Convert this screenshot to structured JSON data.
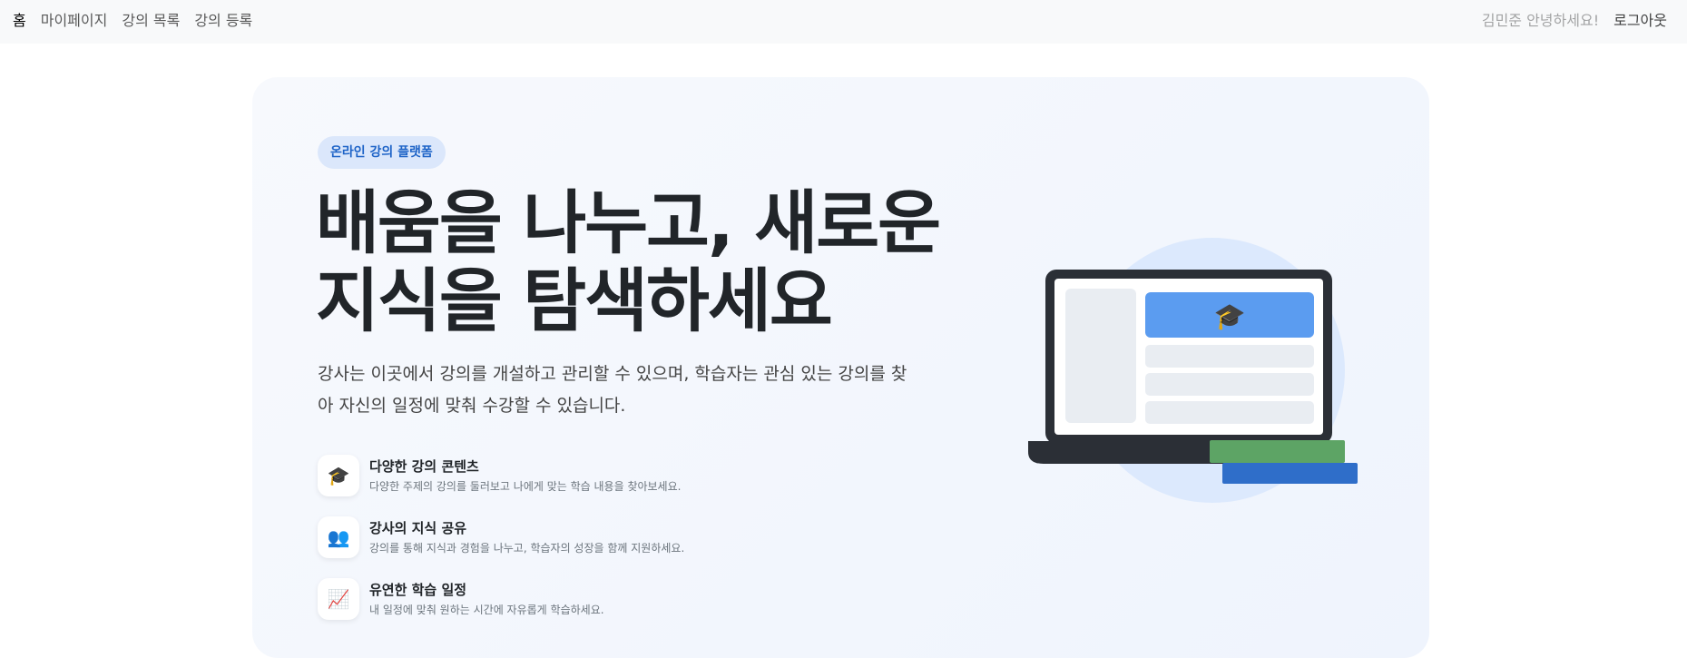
{
  "nav": {
    "home": "홈",
    "mypage": "마이페이지",
    "course_list": "강의 목록",
    "course_register": "강의 등록",
    "greeting": "김민준 안녕하세요!",
    "logout": "로그아웃"
  },
  "hero": {
    "badge": "온라인 강의 플랫폼",
    "title_line1": "배움을 나누고, 새로운",
    "title_line2": "지식을 탐색하세요",
    "description": "강사는 이곳에서 강의를 개설하고 관리할 수 있으며, 학습자는 관심 있는 강의를 찾아 자신의 일정에 맞춰 수강할 수 있습니다."
  },
  "features": [
    {
      "icon": "graduation-cap-icon",
      "glyph": "🎓",
      "title": "다양한 강의 콘텐츠",
      "desc": "다양한 주제의 강의를 둘러보고 나에게 맞는 학습 내용을 찾아보세요."
    },
    {
      "icon": "people-icon",
      "glyph": "👥",
      "title": "강사의 지식 공유",
      "desc": "강의를 통해 지식과 경험을 나누고, 학습자의 성장을 함께 지원하세요."
    },
    {
      "icon": "chart-up-icon",
      "glyph": "📈",
      "title": "유연한 학습 일정",
      "desc": "내 일정에 맞춰 원하는 시간에 자유롭게 학습하세요."
    }
  ],
  "illustration": {
    "cap_glyph": "🎓",
    "colors": {
      "circle": "#dce9fd",
      "laptop_frame": "#2b2f36",
      "screen_bg": "#ffffff",
      "banner": "#5b9cf0",
      "row": "#e9edf2",
      "book_green": "#5da465",
      "book_blue": "#2f6ec9"
    }
  },
  "colors": {
    "accent": "#1d63c7",
    "badge_bg": "#dbe7fb",
    "navbar_bg": "#f8f9fa"
  }
}
